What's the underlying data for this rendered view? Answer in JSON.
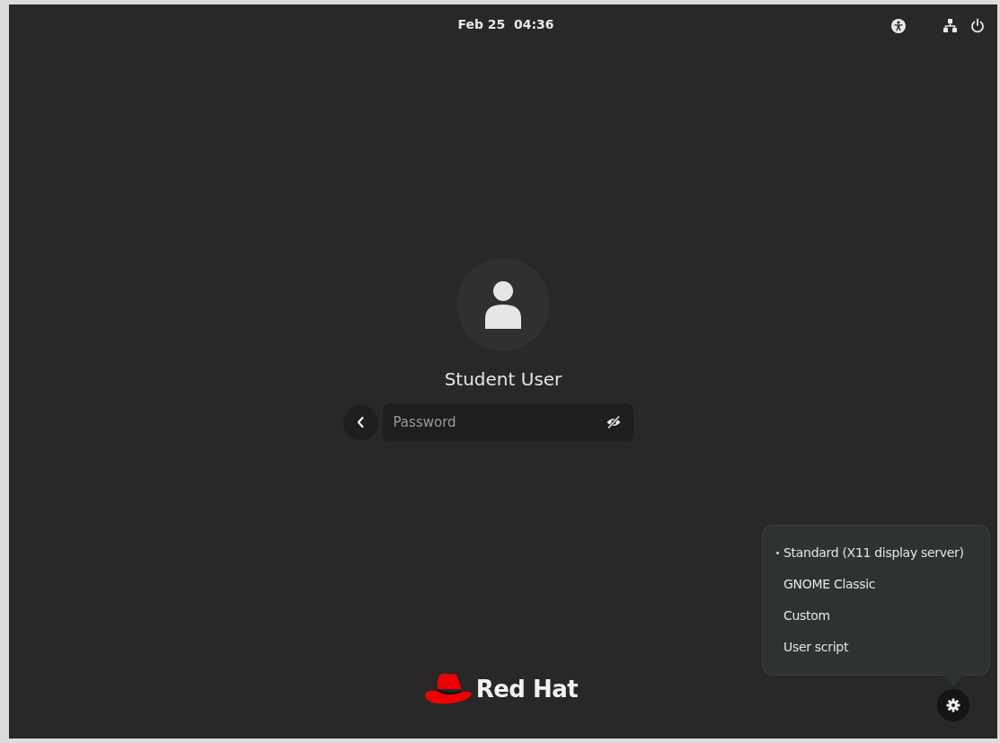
{
  "top_bar": {
    "clock": "Feb 25  04:36"
  },
  "login": {
    "user_name": "Student User",
    "password": {
      "placeholder": "Password"
    }
  },
  "logo": {
    "text": "Red Hat"
  },
  "session_menu": {
    "items": [
      {
        "label": "Standard (X11 display server)",
        "selected": true
      },
      {
        "label": "GNOME Classic",
        "selected": false
      },
      {
        "label": "Custom",
        "selected": false
      },
      {
        "label": "User script",
        "selected": false
      }
    ]
  }
}
